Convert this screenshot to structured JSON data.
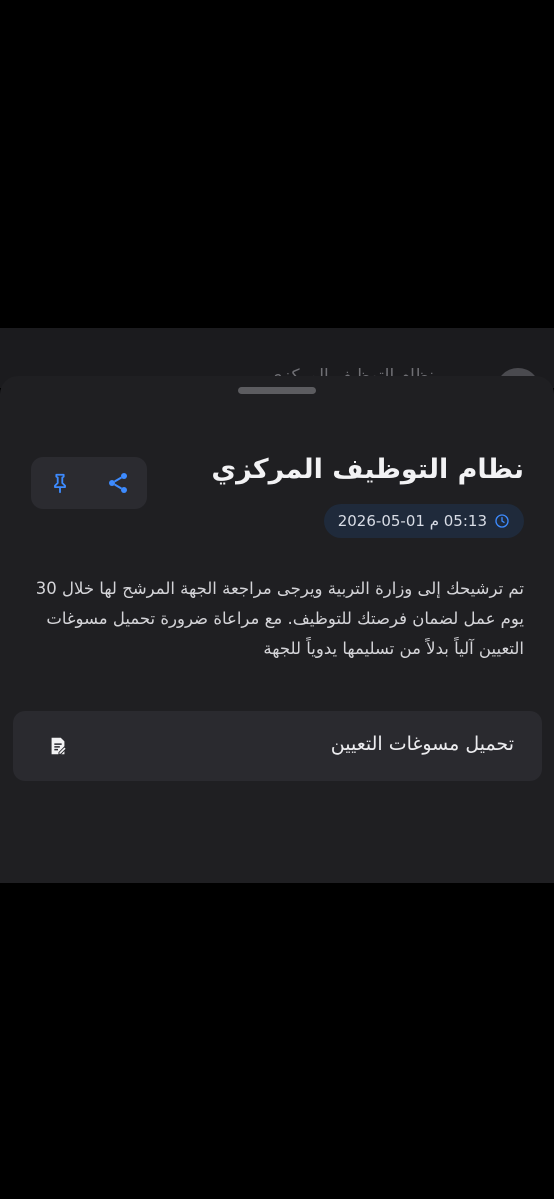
{
  "background_page": {
    "title_partial": "نظام التوظيف المركزي"
  },
  "sheet": {
    "title": "نظام التوظيف المركزي",
    "date": "05:13 م 01-05-2026",
    "body": "تم ترشيحك إلى وزارة التربية ويرجى مراجعة الجهة المرشح لها خلال 30 يوم عمل لضمان فرصتك للتوظيف. مع مراعاة ضرورة تحميل مسوغات التعيين آلياً بدلاً من تسليمها يدوياً للجهة",
    "attachment_label": "تحميل مسوغات التعيين"
  },
  "icons": {
    "pin": "pin-icon",
    "share": "share-icon",
    "clock": "clock-icon",
    "document": "document-edit-icon"
  },
  "colors": {
    "accent": "#3d8bff",
    "sheet_bg": "#1f1f22",
    "chip_bg": "#1f2a3b"
  }
}
